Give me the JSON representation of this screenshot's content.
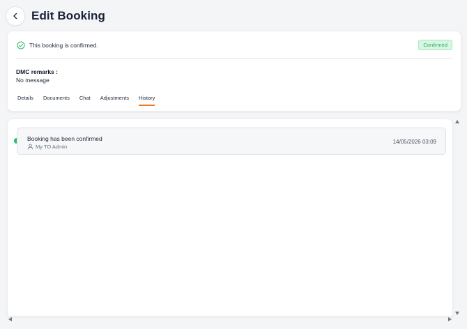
{
  "header": {
    "title": "Edit Booking"
  },
  "booking": {
    "status_message": "This booking is confirmed.",
    "status_badge": "Confirmed",
    "remarks_label": "DMC remarks :",
    "remarks_value": "No message"
  },
  "tabs": [
    {
      "label": "Details"
    },
    {
      "label": "Documents"
    },
    {
      "label": "Chat"
    },
    {
      "label": "Adjustments"
    },
    {
      "label": "History",
      "active": true
    }
  ],
  "history": [
    {
      "title": "Booking has been confirmed",
      "user": "My TO Admin",
      "timestamp": "14/05/2026 03:09"
    }
  ],
  "icons": {
    "back": "chevron-left-icon",
    "status": "check-circle-icon",
    "history_user": "user-icon"
  },
  "colors": {
    "accent_tab": "#f27a21",
    "badge_bg": "#d7f7e3",
    "badge_text": "#2fa865",
    "history_dot": "#22c06f",
    "title": "#1a2238"
  }
}
